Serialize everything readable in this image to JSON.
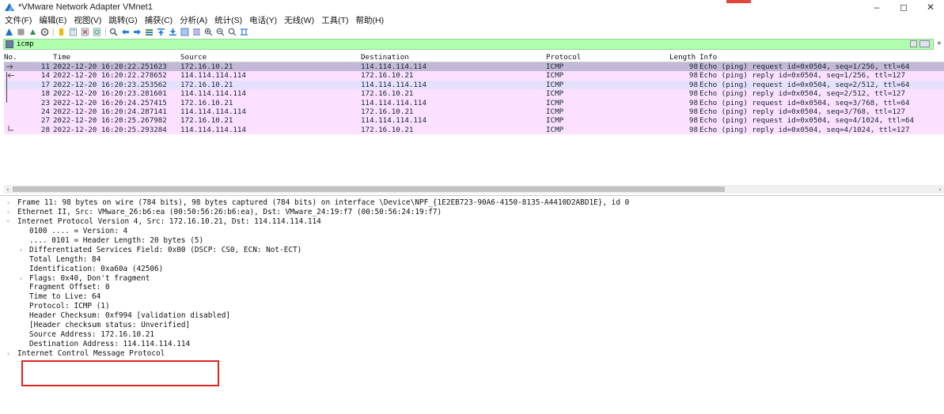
{
  "window": {
    "title": "*VMware Network Adapter VMnet1",
    "controls": [
      "–",
      "◻",
      "✕"
    ]
  },
  "menu": [
    "文件(F)",
    "编辑(E)",
    "视图(V)",
    "跳转(G)",
    "捕获(C)",
    "分析(A)",
    "统计(S)",
    "电话(Y)",
    "无线(W)",
    "工具(T)",
    "帮助(H)"
  ],
  "toolbar": [
    "start-capture-icon",
    "stop-capture-icon",
    "restart-capture-icon",
    "options-icon",
    "open-file-icon",
    "save-file-icon",
    "close-file-icon",
    "reload-icon",
    "find-icon",
    "back-icon",
    "forward-icon",
    "goto-icon",
    "first-icon",
    "last-icon",
    "autoscroll-icon",
    "colorize-icon",
    "zoom-in-icon",
    "zoom-out-icon",
    "zoom-reset-icon",
    "resize-columns-icon"
  ],
  "filter": {
    "value": "icmp"
  },
  "packet_list": {
    "columns": [
      "No.",
      "Time",
      "Source",
      "Destination",
      "Protocol",
      "Length",
      "Info"
    ],
    "rows": [
      {
        "no": "11",
        "time": "2022-12-20 16:20:22.251623",
        "src": "172.16.10.21",
        "dst": "114.114.114.114",
        "proto": "ICMP",
        "len": "98",
        "info": "Echo (ping) request  id=0x0504, seq=1/256, ttl=64"
      },
      {
        "no": "14",
        "time": "2022-12-20 16:20:22.278652",
        "src": "114.114.114.114",
        "dst": "172.16.10.21",
        "proto": "ICMP",
        "len": "98",
        "info": "Echo (ping) reply    id=0x0504, seq=1/256, ttl=127"
      },
      {
        "no": "17",
        "time": "2022-12-20 16:20:23.253562",
        "src": "172.16.10.21",
        "dst": "114.114.114.114",
        "proto": "ICMP",
        "len": "98",
        "info": "Echo (ping) request  id=0x0504, seq=2/512, ttl=64"
      },
      {
        "no": "18",
        "time": "2022-12-20 16:20:23.281601",
        "src": "114.114.114.114",
        "dst": "172.16.10.21",
        "proto": "ICMP",
        "len": "98",
        "info": "Echo (ping) reply    id=0x0504, seq=2/512, ttl=127"
      },
      {
        "no": "23",
        "time": "2022-12-20 16:20:24.257415",
        "src": "172.16.10.21",
        "dst": "114.114.114.114",
        "proto": "ICMP",
        "len": "98",
        "info": "Echo (ping) request  id=0x0504, seq=3/768, ttl=64"
      },
      {
        "no": "24",
        "time": "2022-12-20 16:20:24.287141",
        "src": "114.114.114.114",
        "dst": "172.16.10.21",
        "proto": "ICMP",
        "len": "98",
        "info": "Echo (ping) reply    id=0x0504, seq=3/768, ttl=127"
      },
      {
        "no": "27",
        "time": "2022-12-20 16:20:25.267982",
        "src": "172.16.10.21",
        "dst": "114.114.114.114",
        "proto": "ICMP",
        "len": "98",
        "info": "Echo (ping) request  id=0x0504, seq=4/1024, ttl=64"
      },
      {
        "no": "28",
        "time": "2022-12-20 16:20:25.293284",
        "src": "114.114.114.114",
        "dst": "172.16.10.21",
        "proto": "ICMP",
        "len": "98",
        "info": "Echo (ping) reply    id=0x0504, seq=4/1024, ttl=127"
      }
    ]
  },
  "details": [
    {
      "level": 0,
      "arrow": "›",
      "text": "Frame 11: 98 bytes on wire (784 bits), 98 bytes captured (784 bits) on interface \\Device\\NPF_{1E2EB723-90A6-4150-8135-A4410D2ABD1E}, id 0"
    },
    {
      "level": 0,
      "arrow": "›",
      "text": "Ethernet II, Src: VMware_26:b6:ea (00:50:56:26:b6:ea), Dst: VMware_24:19:f7 (00:50:56:24:19:f7)"
    },
    {
      "level": 0,
      "arrow": "˅",
      "text": "Internet Protocol Version 4, Src: 172.16.10.21, Dst: 114.114.114.114"
    },
    {
      "level": 1,
      "arrow": "",
      "text": "0100 .... = Version: 4"
    },
    {
      "level": 1,
      "arrow": "",
      "text": ".... 0101 = Header Length: 20 bytes (5)"
    },
    {
      "level": 1,
      "arrow": "›",
      "text": "Differentiated Services Field: 0x00 (DSCP: CS0, ECN: Not-ECT)"
    },
    {
      "level": 1,
      "arrow": "",
      "text": "Total Length: 84"
    },
    {
      "level": 1,
      "arrow": "",
      "text": "Identification: 0xa60a (42506)"
    },
    {
      "level": 1,
      "arrow": "›",
      "text": "Flags: 0x40, Don't fragment"
    },
    {
      "level": 1,
      "arrow": "",
      "text": "Fragment Offset: 0"
    },
    {
      "level": 1,
      "arrow": "",
      "text": "Time to Live: 64"
    },
    {
      "level": 1,
      "arrow": "",
      "text": "Protocol: ICMP (1)"
    },
    {
      "level": 1,
      "arrow": "",
      "text": "Header Checksum: 0xf994 [validation disabled]"
    },
    {
      "level": 1,
      "arrow": "",
      "text": "[Header checksum status: Unverified]"
    },
    {
      "level": 1,
      "arrow": "",
      "text": "Source Address: 172.16.10.21"
    },
    {
      "level": 1,
      "arrow": "",
      "text": "Destination Address: 114.114.114.114"
    },
    {
      "level": 0,
      "arrow": "›",
      "text": "Internet Control Message Protocol"
    }
  ]
}
